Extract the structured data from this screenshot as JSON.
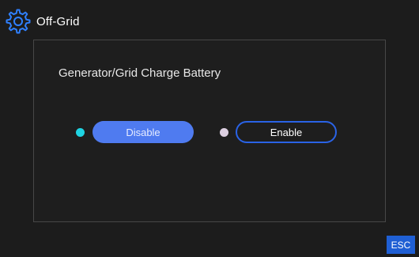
{
  "header": {
    "icon": "gear-icon",
    "title": "Off-Grid"
  },
  "panel": {
    "label": "Generator/Grid Charge Battery",
    "options": [
      {
        "label": "Disable",
        "selected": true,
        "indicator_color": "#1fd4e3"
      },
      {
        "label": "Enable",
        "selected": false,
        "indicator_color": "#dccfe0"
      }
    ]
  },
  "footer": {
    "esc_label": "ESC"
  },
  "colors": {
    "accent": "#4f7bf0",
    "outline": "#2a63e6",
    "esc_background": "#1f5fd4",
    "background": "#1c1c1c"
  }
}
